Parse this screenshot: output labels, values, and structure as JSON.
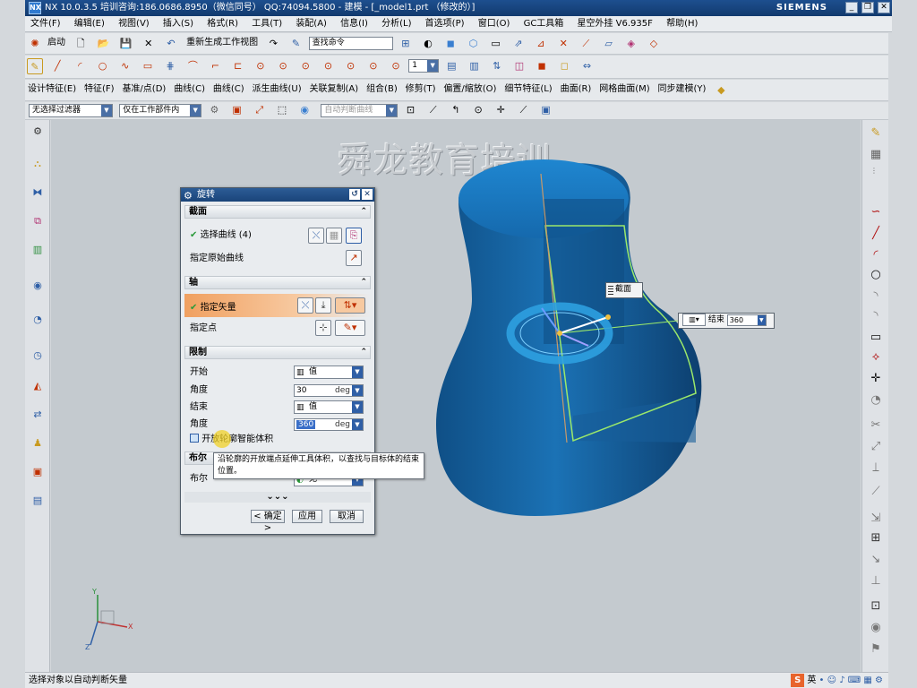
{
  "window": {
    "title": "NX 10.0.3.5 培训咨询:186.0686.8950（微信同号） QQ:74094.5800 - 建模 - [_model1.prt （修改的）]",
    "brand": "SIEMENS",
    "logo_text": "NX",
    "min_label": "_",
    "restore_label": "❐",
    "close_label": "✕"
  },
  "menu": [
    "文件(F)",
    "编辑(E)",
    "视图(V)",
    "插入(S)",
    "格式(R)",
    "工具(T)",
    "装配(A)",
    "信息(I)",
    "分析(L)",
    "首选项(P)",
    "窗口(O)",
    "GC工具箱",
    "星空外挂 V6.935F",
    "帮助(H)"
  ],
  "toolbar": {
    "start_label": "启动",
    "regen_label": "重新生成工作视图",
    "search_placeholder": "查找命令",
    "layer_value": "1",
    "selection_filter": "无选择过滤器",
    "assembly_scope": "仅在工作部件内",
    "snap_filter": "自动判断曲线",
    "feature_menus": [
      "设计特征(E)",
      "特征(F)",
      "基准/点(D)",
      "曲线(C)",
      "曲线(C)",
      "派生曲线(U)",
      "关联复制(A)",
      "组合(B)",
      "修剪(T)",
      "偏置/缩放(O)",
      "细节特征(L)",
      "曲面(R)",
      "网格曲面(M)",
      "同步建模(Y)"
    ]
  },
  "watermark": "舜龙教育培训",
  "dialog": {
    "title": "旋转",
    "reset_label": "↺",
    "close_label": "✕",
    "section_label": "截面",
    "select_curve_label": "选择曲线",
    "select_curve_count": "(4)",
    "specify_origin_curve_label": "指定原始曲线",
    "axis_label": "轴",
    "specify_vector_label": "指定矢量",
    "specify_point_label": "指定点",
    "limits_label": "限制",
    "start_label": "开始",
    "start_option": "值",
    "start_angle_label": "角度",
    "start_angle_value": "30",
    "end_label": "结束",
    "end_option": "值",
    "end_angle_label": "角度",
    "end_angle_value": "360",
    "angle_unit": "deg",
    "open_profile_label": "开放轮廓智能体积",
    "boolean_section_label": "布尔",
    "boolean_label": "布尔",
    "boolean_value": "无",
    "more_label": "⌄⌄⌄",
    "ok_label": "< 确定 >",
    "apply_label": "应用",
    "cancel_label": "取消"
  },
  "tooltip": "沿轮廓的开放端点延伸工具体积，以查找与目标体的结束位置。",
  "callouts": {
    "section_tag": "截面",
    "end_label": "结束",
    "end_value": "360"
  },
  "status": {
    "message": "选择对象以自动判断矢量",
    "ime_logo": "S",
    "ime_lang": "英"
  },
  "colors": {
    "title_bar": "#1a4479",
    "model_blue": "#1a6aa8",
    "vector_highlight": "#f0a060",
    "viewport_bg": "#c4cacf"
  }
}
